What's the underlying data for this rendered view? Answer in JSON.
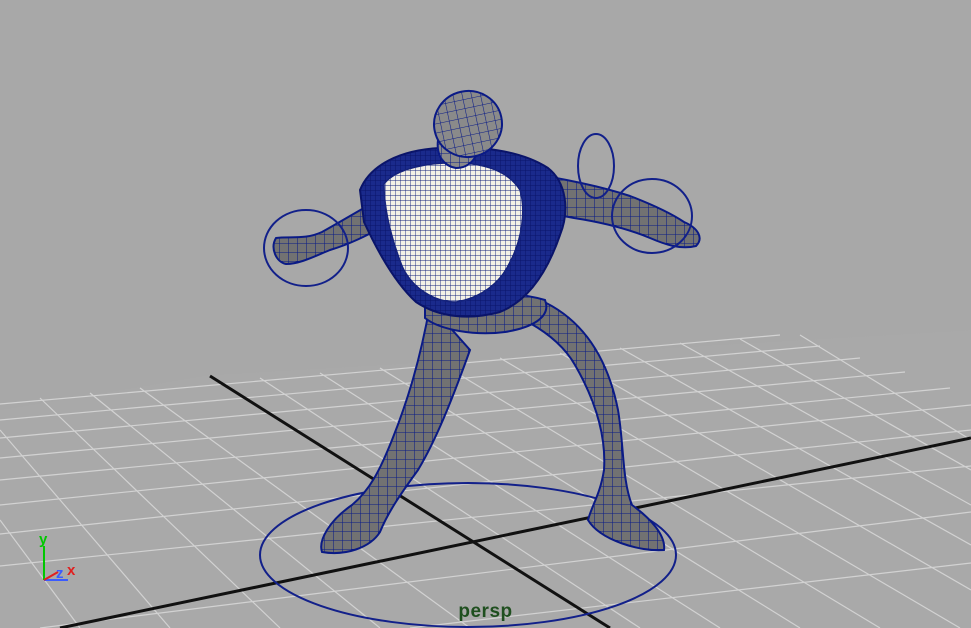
{
  "viewport": {
    "camera_name": "persp",
    "background_color": "#a8a8a8",
    "grid_color": "#d0d0d0",
    "grid_axis_color": "#141414",
    "mesh_color": "#0a1a86",
    "mesh_fill_color": "#767676",
    "selected_mesh_color": "#f2f2ea",
    "control_curve_color": "#12208a"
  },
  "axis_gizmo": {
    "y_label": "y",
    "z_label": "z",
    "x_label": "x",
    "y_color": "#00c800",
    "z_color": "#3a5bff",
    "x_color": "#e02020"
  }
}
